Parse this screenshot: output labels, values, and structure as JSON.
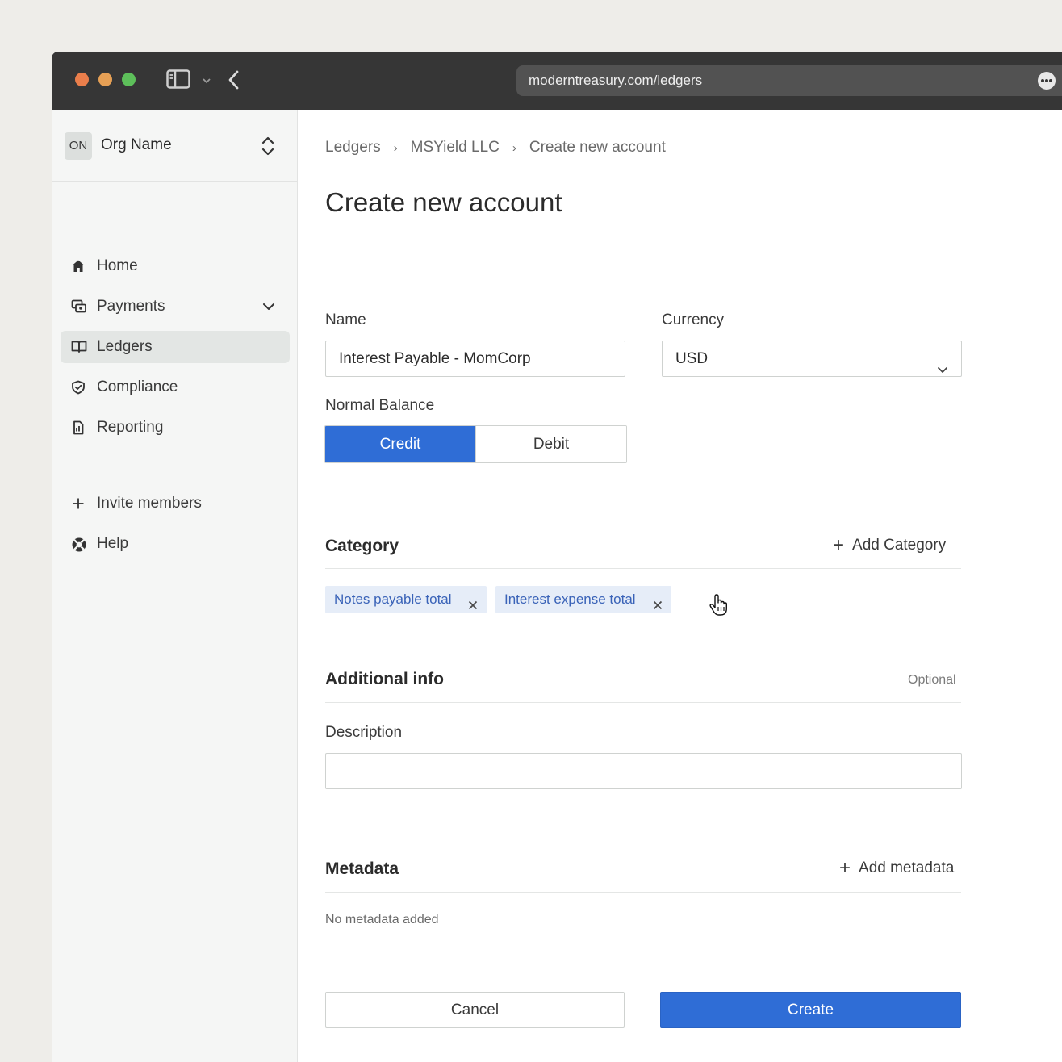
{
  "browser": {
    "url": "moderntreasury.com/ledgers",
    "icons": [
      "sidebar-toggle-icon",
      "chevron-down-icon",
      "back-icon",
      "more-icon"
    ]
  },
  "sidebar": {
    "org": {
      "initials": "ON",
      "name": "Org Name"
    },
    "items": [
      {
        "label": "Home",
        "icon": "home-icon"
      },
      {
        "label": "Payments",
        "icon": "payments-icon"
      },
      {
        "label": "Ledgers",
        "icon": "book-icon",
        "active": true
      },
      {
        "label": "Compliance",
        "icon": "shield-icon"
      },
      {
        "label": "Reporting",
        "icon": "report-icon"
      }
    ],
    "secondary": [
      {
        "label": "Invite members",
        "icon": "plus-icon"
      },
      {
        "label": "Help",
        "icon": "help-icon"
      }
    ]
  },
  "main": {
    "breadcrumbs": [
      "Ledgers",
      "MSYield LLC",
      "Create new account"
    ],
    "title": "Create new account",
    "name": {
      "label": "Name",
      "value": "Interest Payable - MomCorp"
    },
    "currency": {
      "label": "Currency",
      "value": "USD"
    },
    "normal_balance": {
      "label": "Normal Balance",
      "options": [
        "Credit",
        "Debit"
      ],
      "selected": "Credit"
    },
    "category": {
      "title": "Category",
      "action": "Add Category",
      "chips": [
        "Notes payable total",
        "Interest expense total"
      ]
    },
    "additional": {
      "title": "Additional info",
      "optional": "Optional",
      "description_label": "Description",
      "description_value": ""
    },
    "metadata": {
      "title": "Metadata",
      "action": "Add metadata",
      "empty": "No metadata added"
    },
    "buttons": {
      "cancel": "Cancel",
      "create": "Create"
    }
  },
  "colors": {
    "primary": "#2f6dd6",
    "chip_bg": "#e6edf8",
    "chip_text": "#3a63b8",
    "titlebar": "#363636",
    "traffic_red": "#ea7e4b",
    "traffic_yellow": "#e6a055",
    "traffic_green": "#5dbf5a"
  }
}
